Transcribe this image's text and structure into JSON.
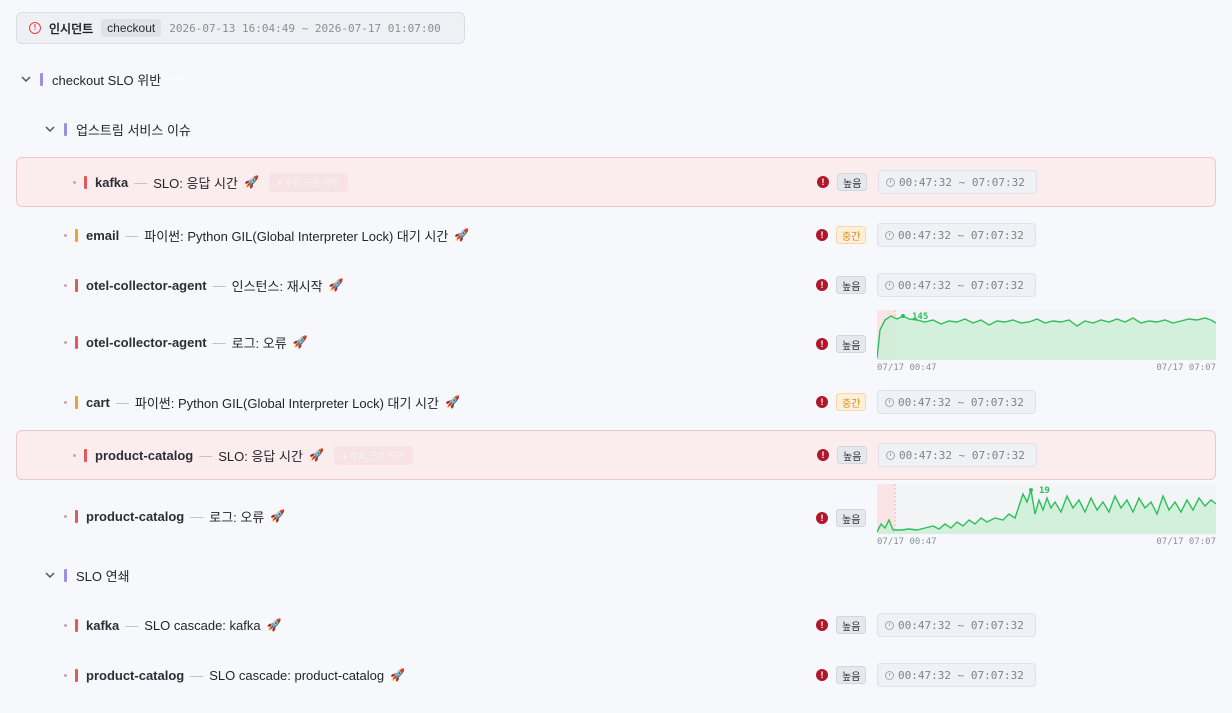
{
  "header": {
    "title": "인시던트",
    "service_tag": "checkout",
    "time_range": "2026-07-13 16:04:49 ~ 2026-07-17 01:07:00"
  },
  "groups": [
    {
      "title": "checkout SLO 위반",
      "badge": ""
    },
    {
      "title": "업스트림 서비스 이슈"
    },
    {
      "title": "SLO 연쇄"
    }
  ],
  "rows": [
    {
      "service": "kafka",
      "description": "SLO: 응답 시간",
      "severity": "높음",
      "severity_level": "high",
      "status_color": "#e05a5a",
      "time_range": "00:47:32 ~ 07:07:32",
      "highlighted": true,
      "ghost_badge": "● 주요 근본 원인"
    },
    {
      "service": "email",
      "description": "파이썬: Python GIL(Global Interpreter Lock) 대기 시간",
      "severity": "중간",
      "severity_level": "mid",
      "status_color": "#f0a030",
      "time_range": "00:47:32 ~ 07:07:32"
    },
    {
      "service": "otel-collector-agent",
      "description": "인스턴스: 재시작",
      "severity": "높음",
      "severity_level": "high",
      "status_color": "#e05a5a",
      "time_range": "00:47:32 ~ 07:07:32"
    },
    {
      "service": "otel-collector-agent",
      "description": "로그: 오류",
      "severity": "높음",
      "severity_level": "high",
      "status_color": "#e05a5a",
      "sparkline": {
        "peak_label": "145",
        "start_label": "07/17 00:47",
        "end_label": "07/17 07:07"
      }
    },
    {
      "service": "cart",
      "description": "파이썬: Python GIL(Global Interpreter Lock) 대기 시간",
      "severity": "중간",
      "severity_level": "mid",
      "status_color": "#f0a030",
      "time_range": "00:47:32 ~ 07:07:32"
    },
    {
      "service": "product-catalog",
      "description": "SLO: 응답 시간",
      "severity": "높음",
      "severity_level": "high",
      "status_color": "#e05a5a",
      "time_range": "00:47:32 ~ 07:07:32",
      "highlighted": true,
      "ghost_badge": "● 주요 근본 원인"
    },
    {
      "service": "product-catalog",
      "description": "로그: 오류",
      "severity": "높음",
      "severity_level": "high",
      "status_color": "#e05a5a",
      "sparkline": {
        "peak_label": "19",
        "start_label": "07/17 00:47",
        "end_label": "07/17 07:07"
      }
    },
    {
      "service": "kafka",
      "description": "SLO cascade: kafka",
      "severity": "높음",
      "severity_level": "high",
      "status_color": "#e05a5a",
      "time_range": "00:47:32 ~ 07:07:32"
    },
    {
      "service": "product-catalog",
      "description": "SLO cascade: product-catalog",
      "severity": "높음",
      "severity_level": "high",
      "status_color": "#e05a5a",
      "time_range": "00:47:32 ~ 07:07:32"
    }
  ],
  "colors": {
    "accent_group": "#9b8fe0",
    "severity_high": "#b0162c",
    "spark_line": "#2fbf5a"
  }
}
